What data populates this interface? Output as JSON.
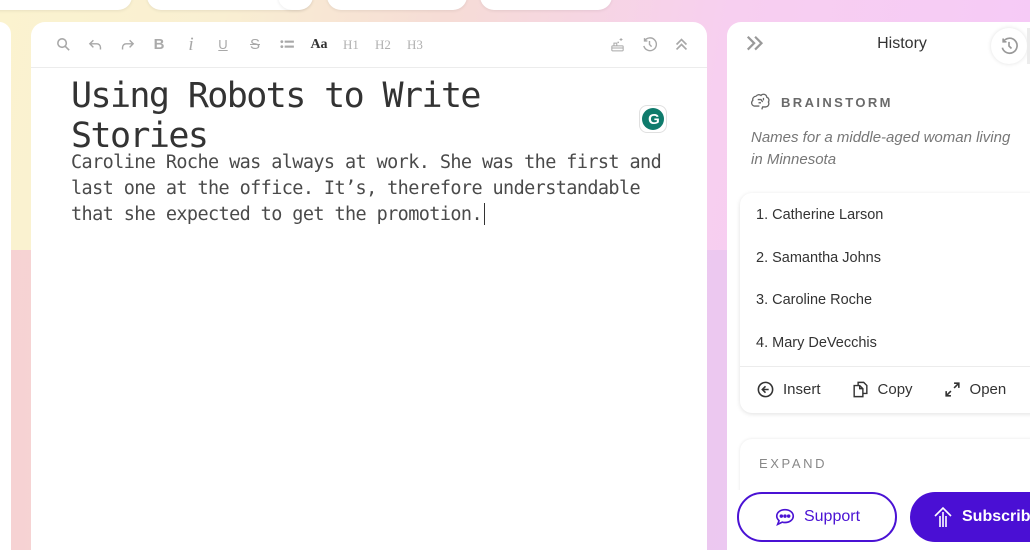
{
  "editor": {
    "toolbar": {
      "bold": "B",
      "italic": "i",
      "underline": "U",
      "strikethrough": "S",
      "font_style": "Aa",
      "h1": "H1",
      "h2": "H2",
      "h3": "H3"
    },
    "title": "Using Robots to Write Stories",
    "grammarly_badge": "G",
    "body": "Caroline Roche was always at work. She was the first and last one at the office. It’s, therefore understandable that she expected to get the promotion."
  },
  "sidebar": {
    "title": "History",
    "section_label": "BRAINSTORM",
    "prompt": "Names for a middle-aged woman living in Minnesota",
    "results": [
      "1. Catherine Larson",
      "2. Samantha Johns",
      "3. Caroline Roche",
      "4. Mary DeVecchis"
    ],
    "actions": {
      "insert": "Insert",
      "copy": "Copy",
      "open": "Open"
    },
    "expand_label": "EXPAND",
    "support_label": "Support",
    "subscribe_label": "Subscrib",
    "accent_color": "#4a12d4"
  }
}
